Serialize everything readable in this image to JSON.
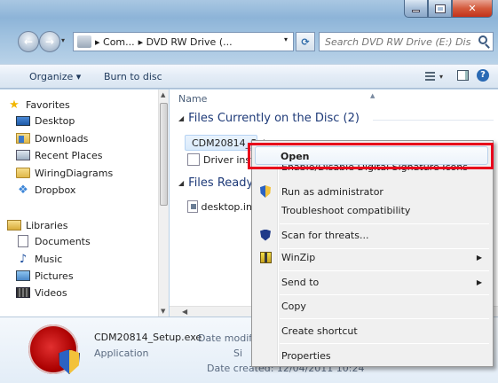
{
  "window": {
    "caption_buttons": [
      "minimize",
      "maximize",
      "close"
    ]
  },
  "nav": {
    "address_segments": [
      "▸ Com...",
      "▸ DVD RW Drive (..."
    ],
    "search_placeholder": "Search DVD RW Drive (E:) Disc"
  },
  "toolbar": {
    "organize_label": "Organize ▾",
    "burn_label": "Burn to disc"
  },
  "sidebar": {
    "favorites_header": "Favorites",
    "favorites": [
      "Desktop",
      "Downloads",
      "Recent Places",
      "WiringDiagrams",
      "Dropbox"
    ],
    "libraries_header": "Libraries",
    "libraries": [
      "Documents",
      "Music",
      "Pictures",
      "Videos"
    ]
  },
  "filelist": {
    "column_name": "Name",
    "groups": [
      {
        "header": "Files Currently on the Disc (2)",
        "files": [
          "CDM20814_Setup.exe",
          "Driver inst"
        ]
      },
      {
        "header": "Files Ready",
        "files": [
          "desktop.ini"
        ]
      }
    ]
  },
  "context_menu": {
    "items": [
      {
        "label": "Open",
        "bold": true,
        "icon": "none"
      },
      {
        "label": "Enable/Disable Digital Signature Icons",
        "icon": "none"
      },
      {
        "label": "Run as administrator",
        "icon": "uac-shield-icon"
      },
      {
        "label": "Troubleshoot compatibility",
        "icon": "none"
      },
      {
        "label": "Scan for threats...",
        "icon": "scan-shield-icon"
      },
      {
        "label": "WinZip",
        "icon": "winzip-icon",
        "submenu": true
      },
      {
        "label": "Send to",
        "icon": "none",
        "submenu": true
      },
      {
        "label": "Copy",
        "icon": "none"
      },
      {
        "label": "Create shortcut",
        "icon": "none"
      },
      {
        "label": "Properties",
        "icon": "none"
      }
    ]
  },
  "details": {
    "filename": "CDM20814_Setup.exe",
    "type": "Application",
    "date_modified_label": "Date modifi",
    "size_label": "Si",
    "date_created": "Date created: 12/04/2011 10:24"
  },
  "colors": {
    "highlight_box": "#e8001c",
    "group_header": "#1e3a78"
  }
}
